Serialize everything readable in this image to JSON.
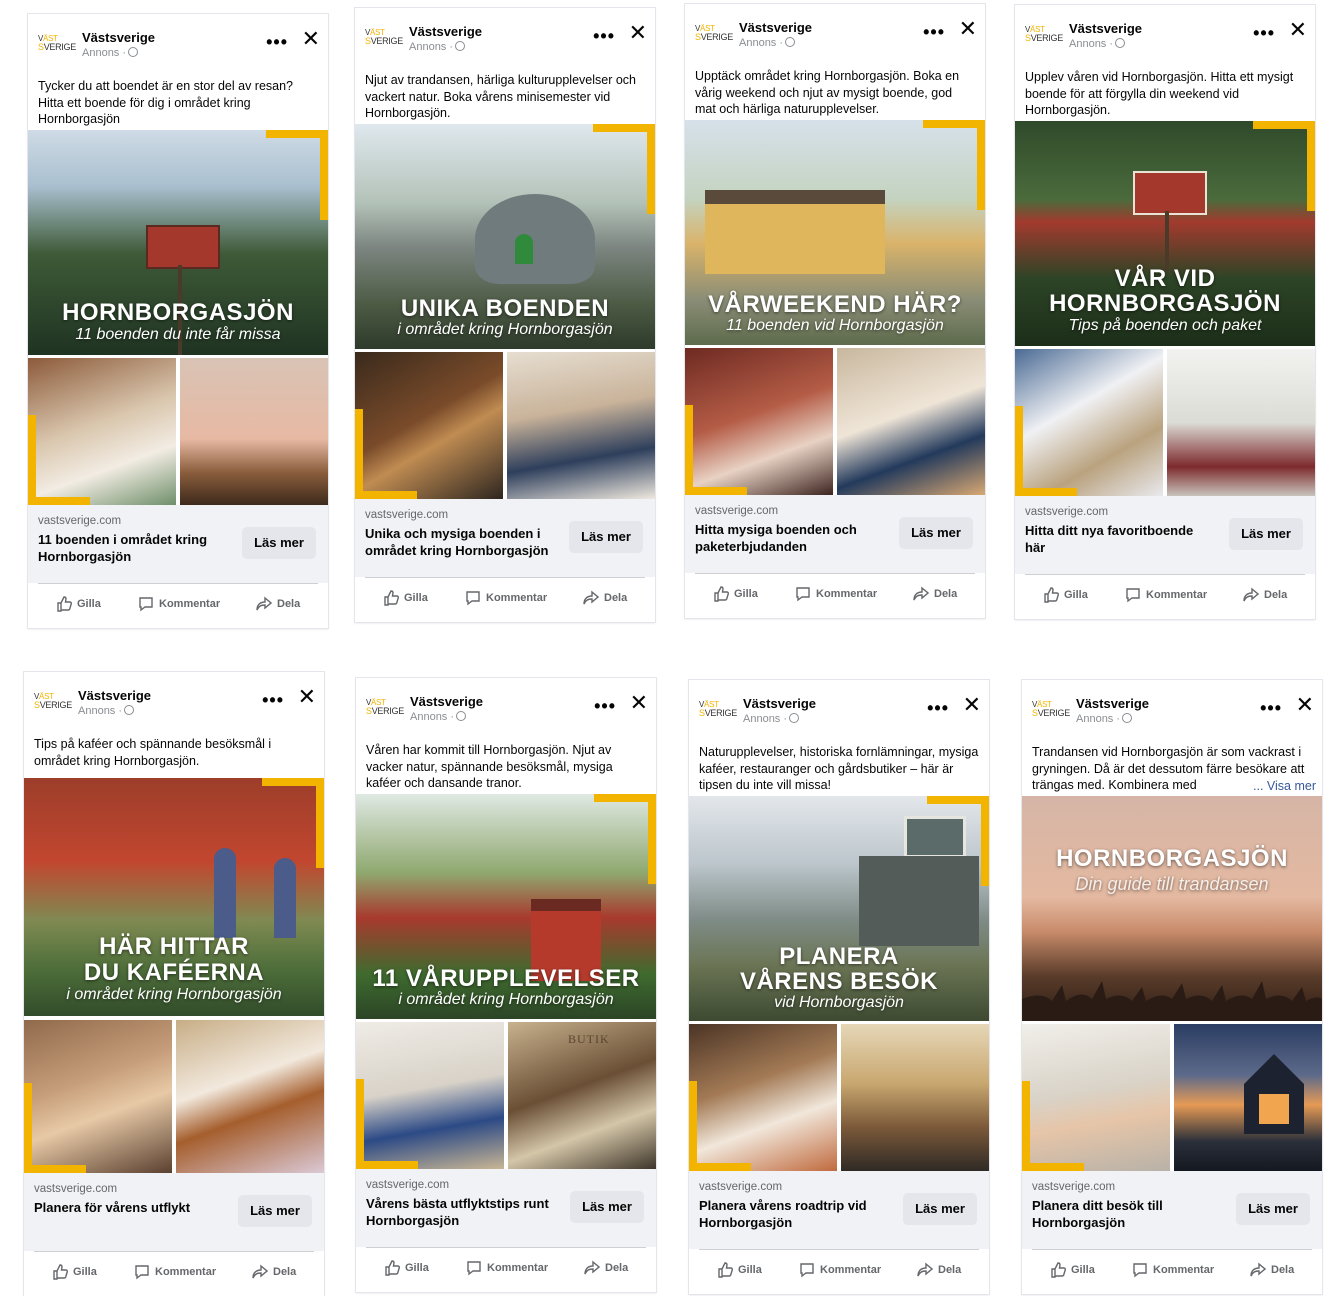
{
  "common": {
    "brand": "Västsverige",
    "sponsored": "Annons ·",
    "logo_top_a": "V",
    "logo_top_b": "ÄST",
    "logo_bottom_a": "S",
    "logo_bottom_b": "VERIGE",
    "more": "•••",
    "close": "✕",
    "domain": "vastsverige.com",
    "cta": "Läs mer",
    "like": "Gilla",
    "comment": "Kommentar",
    "share": "Dela",
    "accent_color": "#f3b400"
  },
  "ads": [
    {
      "text": "Tycker du att boendet är en stor del av resan? Hitta ett boende för dig i området kring Hornborgasjön",
      "hero_title": "HORNBORGASJÖN",
      "hero_sub": "11 boenden du inte får missa",
      "headline": "11 boenden i området kring Hornborgasjön"
    },
    {
      "text": "Njut av trandansen, härliga kulturupplevelser och vackert natur. Boka vårens minisemester vid Hornborgasjön.",
      "hero_title": "UNIKA BOENDEN",
      "hero_sub": "i området kring Hornborgasjön",
      "headline": "Unika och mysiga boenden i området kring Hornborgasjön"
    },
    {
      "text": "Upptäck området kring Hornborgasjön. Boka en vårig weekend och njut av mysigt boende, god mat och härliga naturupplevelser.",
      "hero_title": "VÅRWEEKEND HÄR?",
      "hero_sub": "11 boenden vid Hornborgasjön",
      "headline": "Hitta mysiga boenden och paketerbjudanden"
    },
    {
      "text": "Upplev våren vid Hornborgasjön. Hitta ett mysigt boende för att förgylla din weekend vid Hornborgasjön.",
      "hero_title_1": "VÅR VID",
      "hero_title_2": "HORNBORGASJÖN",
      "hero_sub": "Tips på boenden och paket",
      "headline": "Hitta ditt nya favoritboende här"
    },
    {
      "text": "Tips på kaféer och spännande besöksmål i området kring Hornborgasjön.",
      "hero_title_1": "HÄR HITTAR",
      "hero_title_2": "DU KAFÉERNA",
      "hero_sub": "i området kring Hornborgasjön",
      "headline": "Planera för vårens utflykt"
    },
    {
      "text": "Våren har kommit till Hornborgasjön. Njut av vacker natur, spännande besöksmål, mysiga kaféer och dansande tranor.",
      "hero_title": "11 VÅRUPPLEVELSER",
      "hero_sub": "i området kring Hornborgasjön",
      "headline": "Vårens bästa utflyktstips runt Hornborgasjön",
      "shop_sign": "BUTIK"
    },
    {
      "text": "Naturupplevelser, historiska fornlämningar, mysiga kaféer, restauranger och gårdsbutiker – här är tipsen du inte vill missa!",
      "hero_title_1": "PLANERA",
      "hero_title_2": "VÅRENS BESÖK",
      "hero_sub": "vid Hornborgasjön",
      "headline": "Planera vårens roadtrip vid Hornborgasjön"
    },
    {
      "text": "Trandansen vid Hornborgasjön är som vackrast i gryningen. Då är det dessutom färre besökare att trängas med. Kombinera med",
      "see_more": "... Visa mer",
      "hero_title": "HORNBORGASJÖN",
      "hero_sub": "Din guide till trandansen",
      "headline": "Planera ditt besök till Hornborgasjön"
    }
  ]
}
